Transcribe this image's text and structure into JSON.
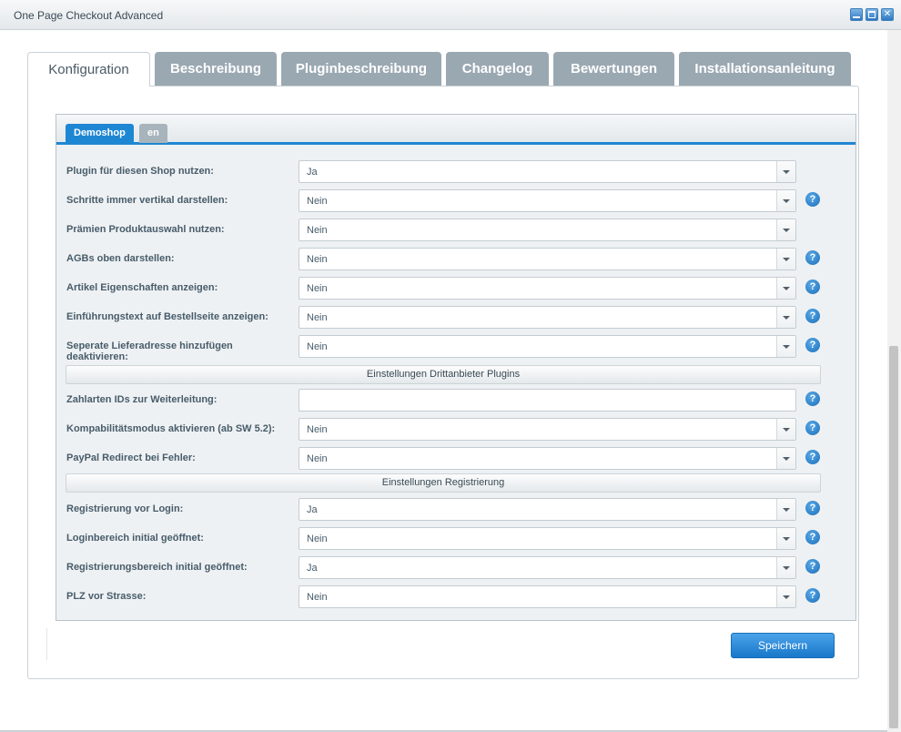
{
  "window": {
    "title": "One Page Checkout Advanced"
  },
  "tabs": [
    {
      "label": "Konfiguration",
      "active": true
    },
    {
      "label": "Beschreibung"
    },
    {
      "label": "Pluginbeschreibung"
    },
    {
      "label": "Changelog"
    },
    {
      "label": "Bewertungen"
    },
    {
      "label": "Installationsanleitung"
    }
  ],
  "shop_tabs": [
    {
      "label": "Demoshop",
      "active": true
    },
    {
      "label": "en"
    }
  ],
  "fields": [
    {
      "label": "Plugin für diesen Shop nutzen:",
      "value": "Ja",
      "help": false
    },
    {
      "label": "Schritte immer vertikal darstellen:",
      "value": "Nein",
      "help": true
    },
    {
      "label": "Prämien Produktauswahl nutzen:",
      "value": "Nein",
      "help": false
    },
    {
      "label": "AGBs oben darstellen:",
      "value": "Nein",
      "help": true
    },
    {
      "label": "Artikel Eigenschaften anzeigen:",
      "value": "Nein",
      "help": true
    },
    {
      "label": "Einführungstext auf Bestellseite anzeigen:",
      "value": "Nein",
      "help": true
    },
    {
      "label": "Seperate Lieferadresse hinzufügen deaktivieren:",
      "value": "Nein",
      "help": true
    },
    {
      "label": "Zahlarten IDs zur Weiterleitung:",
      "value": "",
      "help": true
    },
    {
      "label": "Kompabilitätsmodus aktivieren (ab SW 5.2):",
      "value": "Nein",
      "help": true
    },
    {
      "label": "PayPal Redirect bei Fehler:",
      "value": "Nein",
      "help": true
    },
    {
      "label": "Registrierung vor Login:",
      "value": "Ja",
      "help": true
    },
    {
      "label": "Loginbereich initial geöffnet:",
      "value": "Nein",
      "help": true
    },
    {
      "label": "Registrierungsbereich initial geöffnet:",
      "value": "Ja",
      "help": true
    },
    {
      "label": "PLZ vor Strasse:",
      "value": "Nein",
      "help": true
    }
  ],
  "sections": {
    "third_party": "Einstellungen Drittanbieter Plugins",
    "registration": "Einstellungen Registrierung"
  },
  "help_glyph": "?",
  "save_label": "Speichern",
  "colors": {
    "accent": "#1e87d3",
    "tab_inactive": "#9aa8b2",
    "save_button": "#2a8ad8"
  }
}
